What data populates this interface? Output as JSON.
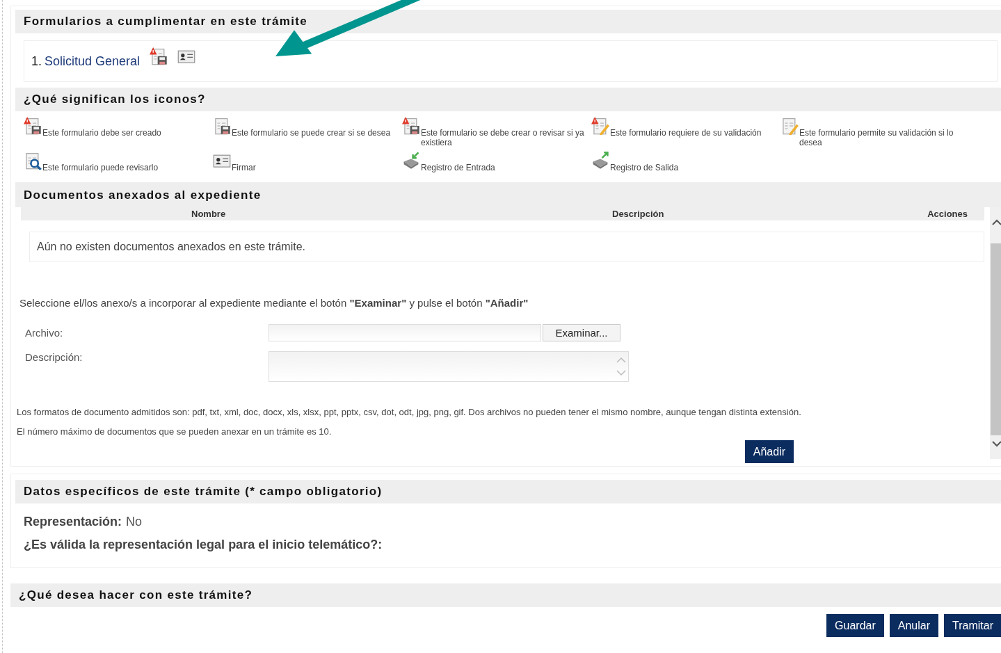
{
  "forms_section": {
    "title": "Formularios a cumplimentar en este trámite",
    "forms": [
      {
        "number": "1.",
        "name": "Solicitud General",
        "icons": [
          {
            "kind": "create_required"
          },
          {
            "kind": "sign"
          }
        ]
      }
    ]
  },
  "legend_section": {
    "title": "¿Qué significan los iconos?",
    "items": [
      {
        "kind": "create_required",
        "text": "Este formulario debe ser creado"
      },
      {
        "kind": "create_optional",
        "text": "Este formulario se puede crear si se desea"
      },
      {
        "kind": "create_or_review",
        "text": "Este formulario se debe crear o revisar si ya existiera"
      },
      {
        "kind": "validate_required",
        "text": "Este formulario requiere de su validación"
      },
      {
        "kind": "validate_optional",
        "text": "Este formulario permite su validación si lo desea"
      },
      {
        "kind": "review",
        "text": "Este formulario puede revisarlo"
      },
      {
        "kind": "sign",
        "text": "Firmar"
      },
      {
        "kind": "entry",
        "text": "Registro de Entrada"
      },
      {
        "kind": "exit",
        "text": "Registro de Salida"
      }
    ]
  },
  "documents_section": {
    "title": "Documentos anexados al expediente",
    "columns": [
      "Nombre",
      "Descripción",
      "Acciones"
    ],
    "empty_message": "Aún no existen documentos anexados en este trámite.",
    "instructions": "Seleccione el/los anexo/s a incorporar al expediente mediante el botón **\"Examinar\"** y pulse el botón **\"Añadir\"**",
    "file_label": "Archivo:",
    "browse_button": "Examinar...",
    "description_label": "Descripción:",
    "formats_note": "Los formatos de documento admitidos son: pdf, txt, xml, doc, docx, xls, xlsx, ppt, pptx, csv, dot, odt, jpg, png, gif. Dos archivos no pueden tener el mismo nombre, aunque tengan distinta extensión.",
    "max_note": "El número máximo de documentos que se pueden anexar en un trámite es 10.",
    "add_button": "Añadir"
  },
  "specific_data_section": {
    "title": "Datos específicos de este trámite (* campo obligatorio)",
    "fields": [
      {
        "label": "Representación:",
        "value": "No"
      },
      {
        "label": "¿Es válida la representación legal para el inicio telemático?:"
      }
    ]
  },
  "actions_section": {
    "title": "¿Qué desea hacer con este trámite?",
    "buttons": [
      "Guardar",
      "Anular",
      "Tramitar"
    ]
  }
}
